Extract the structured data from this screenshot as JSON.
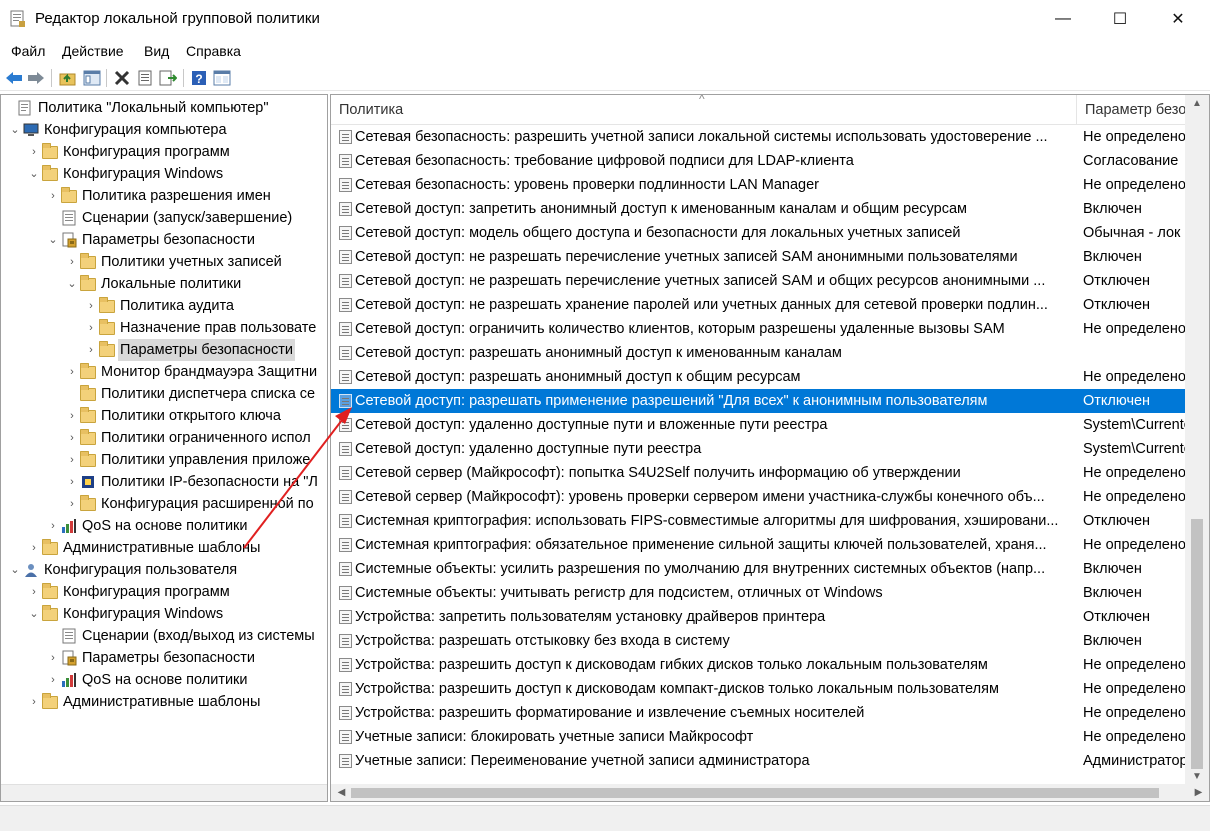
{
  "window": {
    "title": "Редактор локальной групповой политики",
    "minimize": "—",
    "maximize": "☐",
    "close": "✕"
  },
  "menu": {
    "file": "Файл",
    "action": "Действие",
    "view": "Вид",
    "help": "Справка"
  },
  "toolbar": {
    "buttons": [
      "back-arrow-icon",
      "forward-arrow-icon",
      "up-folder-icon",
      "show-hide-tree-icon",
      "delete-icon",
      "properties-icon",
      "export-list-icon",
      "help-icon",
      "extended-view-icon"
    ]
  },
  "tree": {
    "items": [
      {
        "label": "Политика \"Локальный компьютер\""
      },
      {
        "label": "Конфигурация компьютера"
      },
      {
        "label": "Конфигурация программ"
      },
      {
        "label": "Конфигурация Windows"
      },
      {
        "label": "Политика разрешения имен"
      },
      {
        "label": "Сценарии (запуск/завершение)"
      },
      {
        "label": "Параметры безопасности"
      },
      {
        "label": "Политики учетных записей"
      },
      {
        "label": "Локальные политики"
      },
      {
        "label": "Политика аудита"
      },
      {
        "label": "Назначение прав пользовате"
      },
      {
        "label": "Параметры безопасности"
      },
      {
        "label": "Монитор брандмауэра Защитни"
      },
      {
        "label": "Политики диспетчера списка се"
      },
      {
        "label": "Политики открытого ключа"
      },
      {
        "label": "Политики ограниченного испол"
      },
      {
        "label": "Политики управления приложе"
      },
      {
        "label": "Политики IP-безопасности на \"Л"
      },
      {
        "label": "Конфигурация расширенной по"
      },
      {
        "label": "QoS на основе политики"
      },
      {
        "label": "Административные шаблоны"
      },
      {
        "label": "Конфигурация пользователя"
      },
      {
        "label": "Конфигурация программ"
      },
      {
        "label": "Конфигурация Windows"
      },
      {
        "label": "Сценарии (вход/выход из системы"
      },
      {
        "label": "Параметры безопасности"
      },
      {
        "label": "QoS на основе политики"
      },
      {
        "label": "Административные шаблоны"
      }
    ]
  },
  "list": {
    "col_policy": "Политика",
    "col_setting": "Параметр безо",
    "sort_indicator": "^",
    "rows": [
      {
        "name": "Сетевая безопасность: разрешить учетной записи локальной системы использовать удостоверение ...",
        "value": "Не определено"
      },
      {
        "name": "Сетевая безопасность: требование цифровой подписи для LDAP-клиента",
        "value": "Согласование"
      },
      {
        "name": "Сетевая безопасность: уровень проверки подлинности LAN Manager",
        "value": "Не определено"
      },
      {
        "name": "Сетевой доступ: запретить анонимный доступ к именованным каналам и общим ресурсам",
        "value": "Включен"
      },
      {
        "name": "Сетевой доступ: модель общего доступа и безопасности для локальных учетных записей",
        "value": "Обычная - лок"
      },
      {
        "name": "Сетевой доступ: не разрешать перечисление учетных записей SAM анонимными пользователями",
        "value": "Включен"
      },
      {
        "name": "Сетевой доступ: не разрешать перечисление учетных записей SAM и общих ресурсов анонимными ...",
        "value": "Отключен"
      },
      {
        "name": "Сетевой доступ: не разрешать хранение паролей или учетных данных для сетевой проверки подлин...",
        "value": "Отключен"
      },
      {
        "name": "Сетевой доступ: ограничить количество клиентов, которым разрешены удаленные вызовы SAM",
        "value": "Не определено"
      },
      {
        "name": "Сетевой доступ: разрешать анонимный доступ к именованным каналам",
        "value": ""
      },
      {
        "name": "Сетевой доступ: разрешать анонимный доступ к общим ресурсам",
        "value": "Не определено"
      },
      {
        "name": "Сетевой доступ: разрешать применение разрешений \"Для всех\" к анонимным пользователям",
        "value": "Отключен"
      },
      {
        "name": "Сетевой доступ: удаленно доступные пути и вложенные пути реестра",
        "value": "System\\Currentc"
      },
      {
        "name": "Сетевой доступ: удаленно доступные пути реестра",
        "value": "System\\Currentc"
      },
      {
        "name": "Сетевой сервер (Майкрософт): попытка S4U2Self получить информацию об утверждении",
        "value": "Не определено"
      },
      {
        "name": "Сетевой сервер (Майкрософт): уровень проверки сервером имени участника-службы конечного объ...",
        "value": "Не определено"
      },
      {
        "name": "Системная криптография: использовать FIPS-совместимые алгоритмы для шифрования, хэшировани...",
        "value": "Отключен"
      },
      {
        "name": "Системная криптография: обязательное применение сильной защиты ключей пользователей, храня...",
        "value": "Не определено"
      },
      {
        "name": "Системные объекты: усилить разрешения по умолчанию для внутренних системных объектов (напр...",
        "value": "Включен"
      },
      {
        "name": "Системные объекты: учитывать регистр для подсистем, отличных от Windows",
        "value": "Включен"
      },
      {
        "name": "Устройства: запретить пользователям установку драйверов принтера",
        "value": "Отключен"
      },
      {
        "name": "Устройства: разрешать отстыковку без входа в систему",
        "value": "Включен"
      },
      {
        "name": "Устройства: разрешить доступ к дисководам гибких дисков только локальным пользователям",
        "value": "Не определено"
      },
      {
        "name": "Устройства: разрешить доступ к дисководам компакт-дисков только локальным пользователям",
        "value": "Не определено"
      },
      {
        "name": "Устройства: разрешить форматирование и извлечение съемных носителей",
        "value": "Не определено"
      },
      {
        "name": "Учетные записи: блокировать учетные записи Майкрософт",
        "value": "Не определено"
      },
      {
        "name": "Учетные записи: Переименование учетной записи администратора",
        "value": "Администратор"
      }
    ]
  },
  "colors": {
    "selection": "#0078d7",
    "annotation_arrow": "#e02020"
  }
}
